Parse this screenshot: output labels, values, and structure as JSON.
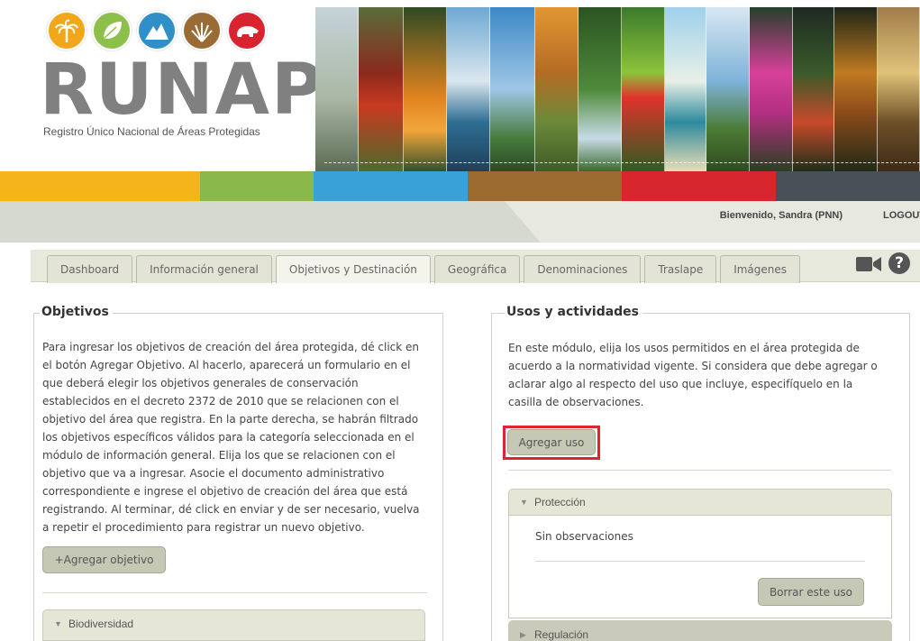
{
  "header": {
    "logo_text": "RUNAP",
    "logo_subtitle": "Registro Único Nacional de Áreas Protegidas",
    "logo_icons": [
      {
        "name": "palm-tree-icon",
        "color": "#f2a71b"
      },
      {
        "name": "leaf-icon",
        "color": "#8cc04a"
      },
      {
        "name": "mountain-icon",
        "color": "#2e8fc9"
      },
      {
        "name": "grass-icon",
        "color": "#9b6b36"
      },
      {
        "name": "bear-icon",
        "color": "#d7242f"
      }
    ],
    "color_bar": [
      "#f4b41a",
      "#8ab84a",
      "#3aa0d8",
      "#9b6a2f",
      "#d7262d",
      "#4a5058"
    ]
  },
  "user_bar": {
    "welcome": "Bienvenido, Sandra (PNN)",
    "logout": "LOGOUT"
  },
  "tabs": [
    {
      "label": "Dashboard"
    },
    {
      "label": "Información general"
    },
    {
      "label": "Objetivos y Destinación",
      "active": true
    },
    {
      "label": "Geográfica"
    },
    {
      "label": "Denominaciones"
    },
    {
      "label": "Traslape"
    },
    {
      "label": "Imágenes"
    }
  ],
  "toolbar_icons": [
    "video-camera-icon",
    "help-icon"
  ],
  "objetivos": {
    "title": "Objetivos",
    "description": "Para ingresar los objetivos de creación del área protegida, dé click en el botón Agregar Objetivo. Al hacerlo, aparecerá un formulario en el que deberá elegir los objetivos generales de conservación establecidos en el decreto 2372 de 2010 que se relacionen con el objetivo del área que registra. En la parte derecha, se habrán filtrado los objetivos específicos válidos para la categoría seleccionada en el módulo de información general. Elija los que se relacionen con el objetivo que va a ingresar. Asocie el documento administrativo correspondiente e ingrese el objetivo de creación del área que está registrando. Al terminar, dé click en enviar y de ser necesario, vuelva a repetir el procedimiento para registrar un nuevo objetivo.",
    "add_button": "+Agregar objetivo",
    "sections": [
      {
        "label": "Biodiversidad"
      }
    ]
  },
  "usos": {
    "title": "Usos y actividades",
    "description": "En este módulo, elija los usos permitidos en el área protegida de acuerdo a la normatividad vigente. Si considera que debe agregar o aclarar algo al respecto del uso que incluye, especifíquelo en la casilla de observaciones.",
    "add_button": "Agregar uso",
    "highlight_color": "#e0242f",
    "sections": [
      {
        "label": "Protección",
        "expanded": true,
        "observations": "Sin observaciones",
        "delete_button": "Borrar este uso"
      },
      {
        "label": "Regulación",
        "expanded": false
      }
    ]
  }
}
